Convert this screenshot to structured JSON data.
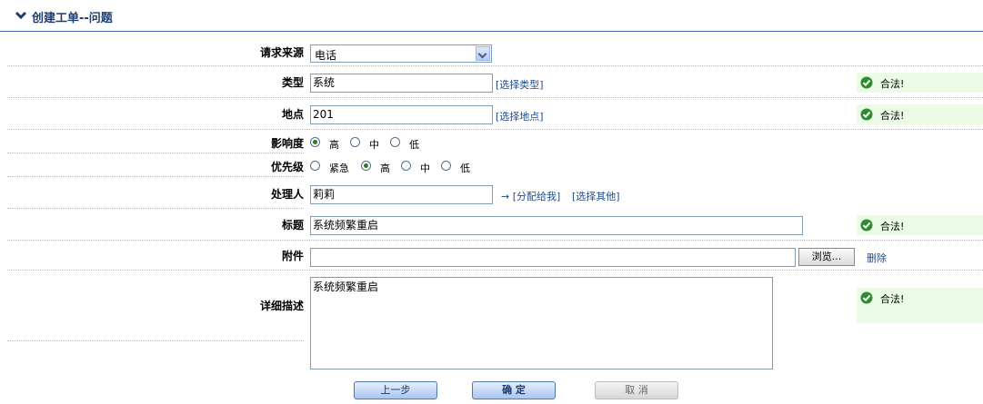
{
  "header": {
    "title": "创建工单--问题",
    "icon": "chevron-down-icon"
  },
  "form": {
    "source": {
      "label": "请求来源",
      "value": "电话"
    },
    "type": {
      "label": "类型",
      "value": "系统",
      "link": "[选择类型]"
    },
    "location": {
      "label": "地点",
      "value": "201",
      "link": "[选择地点]"
    },
    "impact": {
      "label": "影响度",
      "options": [
        "高",
        "中",
        "低"
      ],
      "selected": "高"
    },
    "priority": {
      "label": "优先级",
      "options": [
        "紧急",
        "高",
        "中",
        "低"
      ],
      "selected": "高"
    },
    "handler": {
      "label": "处理人",
      "value": "莉莉",
      "assign_link": "→ [分配给我]",
      "choose_link": "[选择其他]"
    },
    "subject": {
      "label": "标题",
      "value": "系统频繁重启"
    },
    "attachment": {
      "label": "附件",
      "value": "",
      "browse": "浏览...",
      "delete": "删除"
    },
    "description": {
      "label": "详细描述",
      "value": "系统频繁重启"
    }
  },
  "validation": {
    "text": "合法!",
    "color": "#ebfbe6",
    "icon": "check-circle-icon"
  },
  "buttons": {
    "prev": "上一步",
    "confirm": "确 定",
    "cancel": "取 消"
  }
}
